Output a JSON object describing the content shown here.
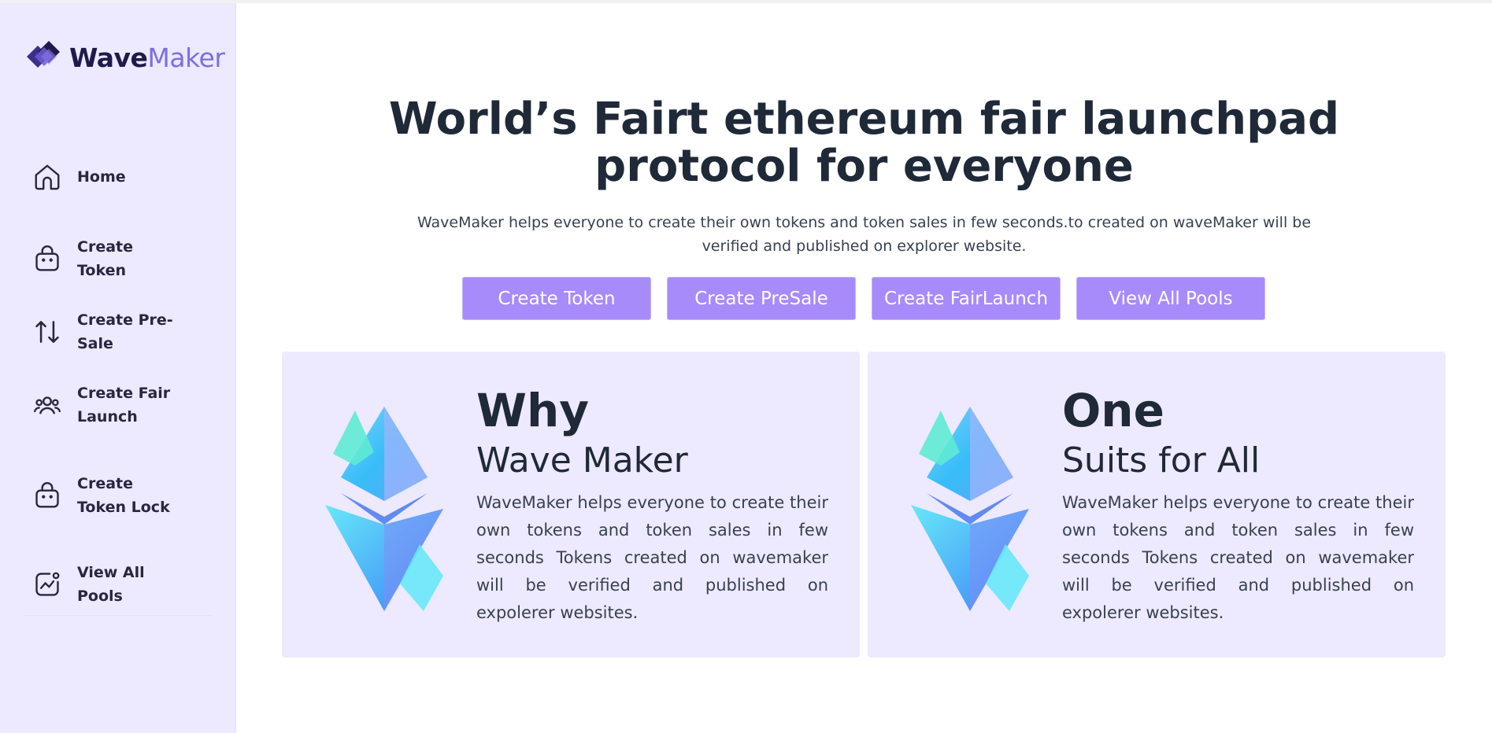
{
  "brand": {
    "name_part1": "Wave",
    "name_part2": "Maker"
  },
  "sidebar": {
    "items": [
      {
        "label": "Home",
        "icon": "home-icon"
      },
      {
        "label": "Create Token",
        "icon": "bag-icon"
      },
      {
        "label": "Create Pre-Sale",
        "icon": "arrows-up-down-icon"
      },
      {
        "label": "Create Fair Launch",
        "icon": "users-icon"
      },
      {
        "label": "Create Token Lock",
        "icon": "bag-icon"
      },
      {
        "label": "View All Pools",
        "icon": "chart-icon"
      }
    ]
  },
  "hero": {
    "title_line1": "World’s Fairt ethereum fair launchpad",
    "title_line2": "protocol for everyone",
    "subtitle": "WaveMaker helps everyone to create their own tokens and token sales in few seconds.to created on waveMaker will be verified and published on explorer website."
  },
  "buttons": {
    "create_token": "Create Token",
    "create_presale": "Create PreSale",
    "create_fairlaunch": "Create FairLaunch",
    "view_all_pools": "View All Pools"
  },
  "cards": [
    {
      "title_main": "Why",
      "title_sub": "Wave Maker",
      "body": "WaveMaker helps everyone to create their own tokens and token sales in few seconds Tokens created on wavemaker will be verified and published on expolerer websites.",
      "icon": "ethereum-crystal-icon"
    },
    {
      "title_main": "One",
      "title_sub": "Suits for All",
      "body": "WaveMaker helps everyone to create their own tokens and token sales in few seconds Tokens created on wavemaker will be verified and published on expolerer websites.",
      "icon": "ethereum-crystal-icon"
    }
  ],
  "colors": {
    "sidebar_bg": "#ede9fe",
    "button_bg": "#a78bfa",
    "brand_accent": "#7c6fe0",
    "heading": "#1f2937"
  }
}
